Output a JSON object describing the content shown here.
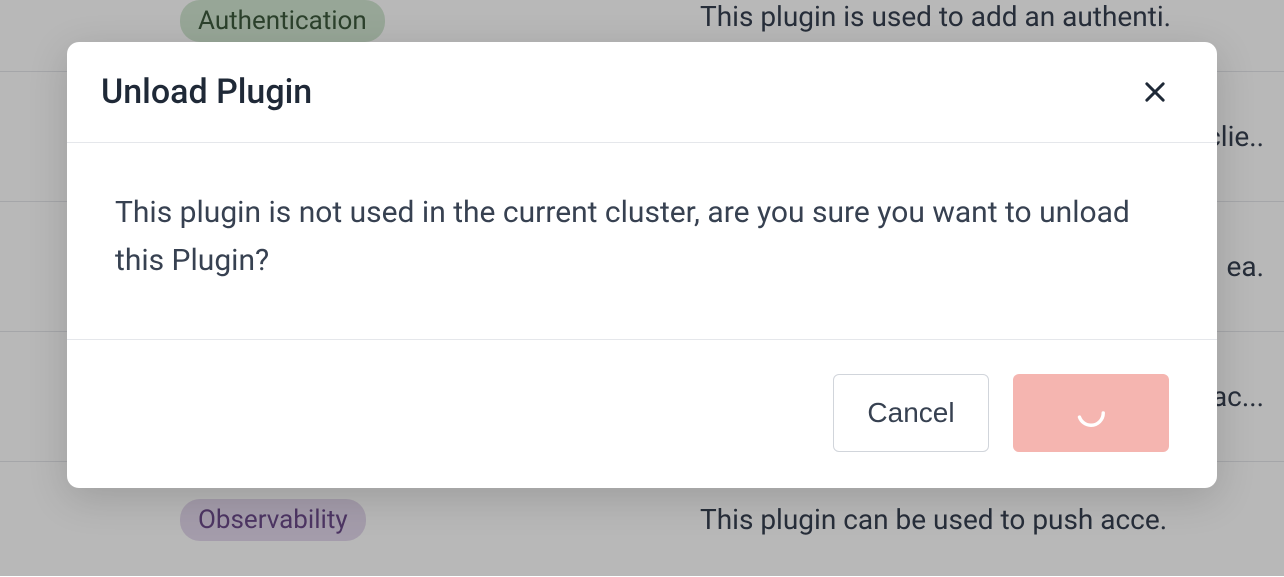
{
  "background": {
    "rows": [
      {
        "tag": "Authentication",
        "tag_class": "tag-green",
        "desc": "This plugin is used to add an authenti."
      },
      {
        "tag": "",
        "tag_class": "",
        "desc": "clie.."
      },
      {
        "tag": "",
        "tag_class": "",
        "desc": "ea."
      },
      {
        "tag": "",
        "tag_class": "",
        "desc": "ac..."
      },
      {
        "tag": "Observability",
        "tag_class": "tag-purple",
        "desc": "This plugin can be used to push acce."
      }
    ]
  },
  "modal": {
    "title": "Unload Plugin",
    "body": "This plugin is not used in the current cluster, are you sure you want to unload this Plugin?",
    "cancel_label": "Cancel"
  }
}
